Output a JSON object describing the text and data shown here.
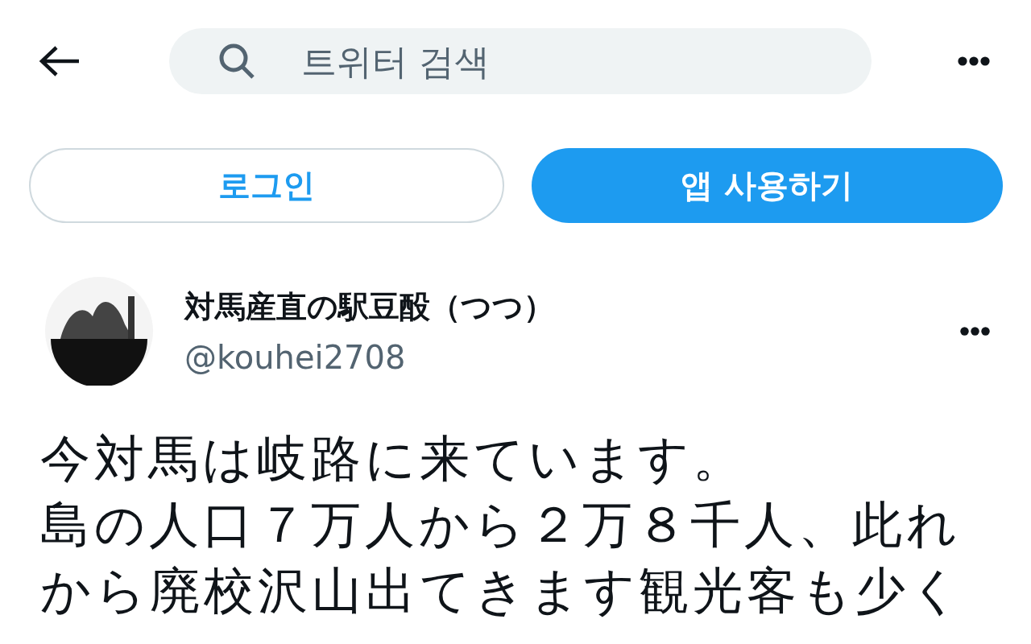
{
  "search": {
    "placeholder": "트위터 검색"
  },
  "buttons": [
    {
      "label": "로그인",
      "kind": "outline"
    },
    {
      "label": "앱 사용하기",
      "kind": "filled"
    }
  ],
  "profile": {
    "name": "対馬産直の駅豆酘（つつ）",
    "handle": "@kouhei2708"
  },
  "tweet": {
    "paragraphs": [
      "今対馬は岐路に来ています。",
      "島の人口７万人から２万８千人、此れから廃校沢山出てきます観光客も少く"
    ]
  }
}
